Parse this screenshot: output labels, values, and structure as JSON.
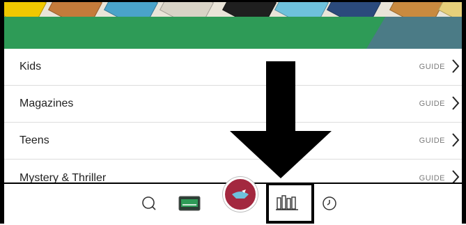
{
  "categories": [
    {
      "label": "Kids",
      "action": "GUIDE"
    },
    {
      "label": "Magazines",
      "action": "GUIDE"
    },
    {
      "label": "Teens",
      "action": "GUIDE"
    },
    {
      "label": "Mystery & Thriller",
      "action": "GUIDE"
    }
  ],
  "icons": {
    "row_chevron": "chevron-right-icon",
    "nav": [
      "search-icon",
      "library-card-icon",
      "home-icon",
      "shelf-icon",
      "history-icon"
    ]
  },
  "colors": {
    "banner_green": "#2e9b57",
    "banner_slate": "#4b7b86",
    "home_circle": "#a3283f",
    "row_text": "#222222",
    "guide_text": "#7a7a7a"
  }
}
